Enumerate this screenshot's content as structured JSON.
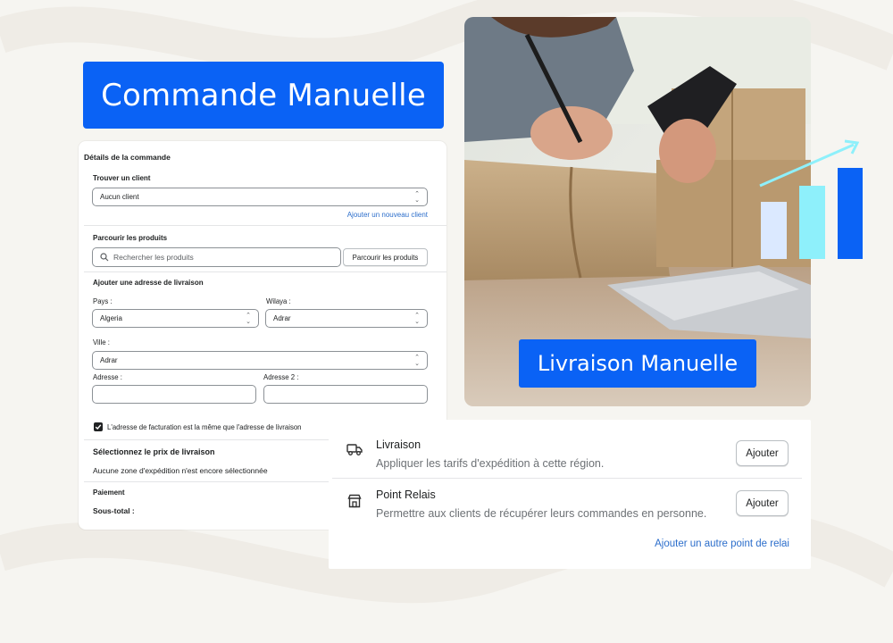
{
  "banner": {
    "title": "Commande Manuelle"
  },
  "order_form": {
    "title": "Détails de la commande",
    "customer": {
      "label": "Trouver un client",
      "selected": "Aucun client",
      "add_link": "Ajouter un nouveau client"
    },
    "products": {
      "label": "Parcourir les produits",
      "search_placeholder": "Rechercher les produits",
      "browse_button": "Parcourir les produits"
    },
    "shipping_address": {
      "label": "Ajouter une adresse de livraison",
      "country_label": "Pays :",
      "country_value": "Algeria",
      "wilaya_label": "Wilaya :",
      "wilaya_value": "Adrar",
      "city_label": "Ville :",
      "city_value": "Adrar",
      "address1_label": "Adresse :",
      "address2_label": "Adresse 2 :",
      "billing_same_label": "L'adresse de facturation est la même que l'adresse de livraison",
      "billing_same_checked": true
    },
    "delivery_price": {
      "label": "Sélectionnez le prix de livraison",
      "empty_text": "Aucune zone d'expédition n'est encore sélectionnée"
    },
    "payment": {
      "label": "Paiement",
      "subtotal_label": "Sous-total :"
    }
  },
  "photo_pill": {
    "label": "Livraison Manuelle"
  },
  "chart_icon": {
    "bar_colors": [
      "#dbe9ff",
      "#8ef0fb",
      "#0a62f5"
    ]
  },
  "shipping_options": {
    "items": [
      {
        "icon": "truck-icon",
        "title": "Livraison",
        "subtitle": "Appliquer les tarifs d'expédition à cette région.",
        "button": "Ajouter"
      },
      {
        "icon": "store-icon",
        "title": "Point Relais",
        "subtitle": "Permettre aux clients de récupérer leurs commandes en personne.",
        "button": "Ajouter"
      }
    ],
    "add_link": "Ajouter un autre point de relai"
  },
  "colors": {
    "accent": "#0a62f5",
    "link": "#2c6ecb",
    "background": "#f6f5f1"
  }
}
